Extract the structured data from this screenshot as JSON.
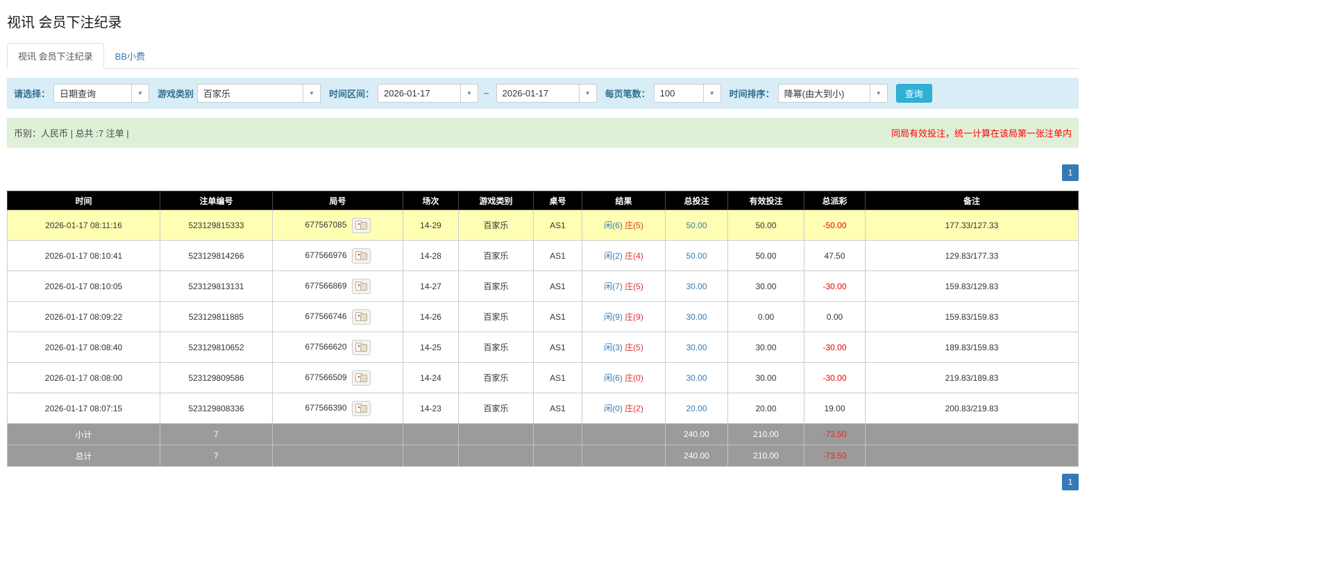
{
  "colors": {
    "accent": "#337ab7",
    "filter-bg": "#d9edf7",
    "filter-label": "#31708f",
    "info-bg": "#dff0d8",
    "warn-red": "#ff0000",
    "neg-red": "#e60000",
    "highlight": "#ffffb3",
    "header-bg": "#000000",
    "footer-bg": "#9b9b9b",
    "search-btn": "#31b0d5",
    "player-blue": "#337ab7",
    "banker-red": "#e03131"
  },
  "icons": {
    "caret_down": "▼"
  },
  "page": {
    "title": "视讯 会员下注纪录"
  },
  "tabs": [
    {
      "label": "视讯 会员下注纪录"
    },
    {
      "label": "BB小费"
    }
  ],
  "filters": {
    "select_label": "请选择：",
    "select_value": "日期查询",
    "game_label": "游戏类别",
    "game_value": "百家乐",
    "range_label": "时间区间：",
    "date_from": "2026-01-17",
    "range_separator": "~",
    "date_to": "2026-01-17",
    "page_size_label": "每页笔数：",
    "page_size_value": "100",
    "sort_label": "时间排序：",
    "sort_value": "降幂(由大到小)",
    "search_button": "查询"
  },
  "info_bar": {
    "summary": "币别：人民币 | 总共 :7 注单 |",
    "notice": "同局有效投注，统一计算在该局第一张注单内"
  },
  "pagination": {
    "current_page": "1"
  },
  "table": {
    "headers": [
      "时间",
      "注单编号",
      "局号",
      "场次",
      "游戏类别",
      "桌号",
      "结果",
      "总投注",
      "有效投注",
      "总派彩",
      "备注"
    ],
    "rows": [
      {
        "time": "2026-01-17 08:11:16",
        "bet_no": "523129815333",
        "round_no": "677567085",
        "session": "14-29",
        "game": "百家乐",
        "table_no": "AS1",
        "result_player": "闲(6)",
        "result_banker": "庄(5)",
        "total_bet": "50.00",
        "valid_bet": "50.00",
        "payout": "-50.00",
        "payout_negative": true,
        "note": "177.33/127.33",
        "highlight": true
      },
      {
        "time": "2026-01-17 08:10:41",
        "bet_no": "523129814266",
        "round_no": "677566976",
        "session": "14-28",
        "game": "百家乐",
        "table_no": "AS1",
        "result_player": "闲(2)",
        "result_banker": "庄(4)",
        "total_bet": "50.00",
        "valid_bet": "50.00",
        "payout": "47.50",
        "payout_negative": false,
        "note": "129.83/177.33",
        "highlight": false
      },
      {
        "time": "2026-01-17 08:10:05",
        "bet_no": "523129813131",
        "round_no": "677566869",
        "session": "14-27",
        "game": "百家乐",
        "table_no": "AS1",
        "result_player": "闲(7)",
        "result_banker": "庄(5)",
        "total_bet": "30.00",
        "valid_bet": "30.00",
        "payout": "-30.00",
        "payout_negative": true,
        "note": "159.83/129.83",
        "highlight": false
      },
      {
        "time": "2026-01-17 08:09:22",
        "bet_no": "523129811885",
        "round_no": "677566746",
        "session": "14-26",
        "game": "百家乐",
        "table_no": "AS1",
        "result_player": "闲(9)",
        "result_banker": "庄(9)",
        "total_bet": "30.00",
        "valid_bet": "0.00",
        "payout": "0.00",
        "payout_negative": false,
        "note": "159.83/159.83",
        "highlight": false
      },
      {
        "time": "2026-01-17 08:08:40",
        "bet_no": "523129810652",
        "round_no": "677566620",
        "session": "14-25",
        "game": "百家乐",
        "table_no": "AS1",
        "result_player": "闲(3)",
        "result_banker": "庄(5)",
        "total_bet": "30.00",
        "valid_bet": "30.00",
        "payout": "-30.00",
        "payout_negative": true,
        "note": "189.83/159.83",
        "highlight": false
      },
      {
        "time": "2026-01-17 08:08:00",
        "bet_no": "523129809586",
        "round_no": "677566509",
        "session": "14-24",
        "game": "百家乐",
        "table_no": "AS1",
        "result_player": "闲(6)",
        "result_banker": "庄(0)",
        "total_bet": "30.00",
        "valid_bet": "30.00",
        "payout": "-30.00",
        "payout_negative": true,
        "note": "219.83/189.83",
        "highlight": false
      },
      {
        "time": "2026-01-17 08:07:15",
        "bet_no": "523129808336",
        "round_no": "677566390",
        "session": "14-23",
        "game": "百家乐",
        "table_no": "AS1",
        "result_player": "闲(0)",
        "result_banker": "庄(2)",
        "total_bet": "20.00",
        "valid_bet": "20.00",
        "payout": "19.00",
        "payout_negative": false,
        "note": "200.83/219.83",
        "highlight": false
      }
    ],
    "footer_rows": [
      {
        "label": "小计",
        "count": "7",
        "total_bet": "240.00",
        "valid_bet": "210.00",
        "payout": "-73.50",
        "payout_negative": true
      },
      {
        "label": "总计",
        "count": "7",
        "total_bet": "240.00",
        "valid_bet": "210.00",
        "payout": "-73.50",
        "payout_negative": true
      }
    ]
  }
}
